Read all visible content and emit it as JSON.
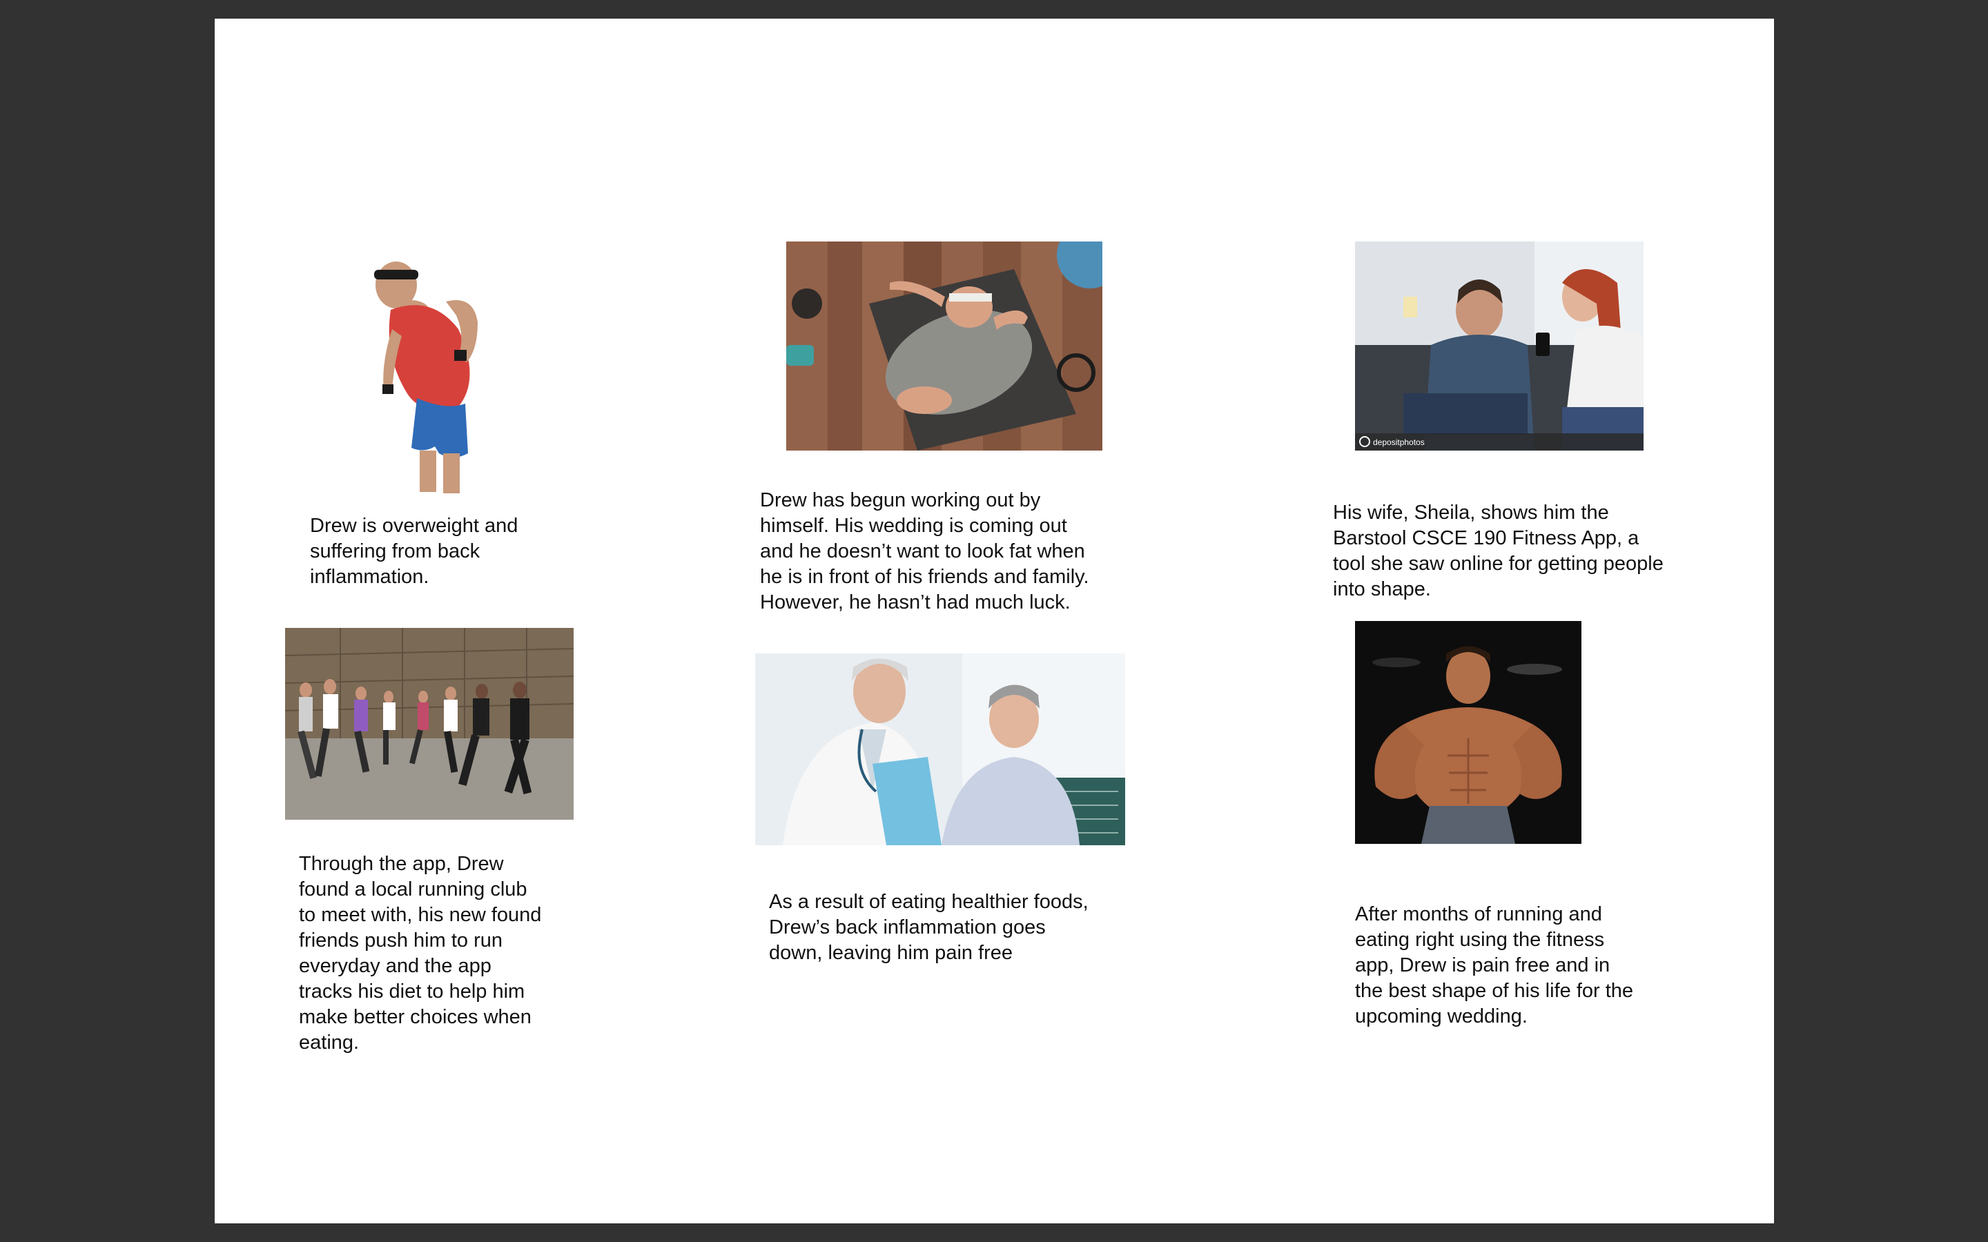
{
  "storyboard": {
    "panels": [
      {
        "image": "overweight-man-back-pain",
        "caption_lines": [
          "Drew is overweight and",
          "suffering from back",
          "inflammation."
        ]
      },
      {
        "image": "man-lying-on-gym-floor",
        "caption_lines": [
          "Drew has begun working out by",
          "himself. His wedding is coming out",
          "and he doesn’t want to look fat when",
          "he is in front of his friends and family.",
          "However, he hasn’t had much luck."
        ]
      },
      {
        "image": "wife-showing-phone-app",
        "caption_lines": [
          "His wife, Sheila, shows him the",
          "Barstool CSCE 190 Fitness App, a",
          "tool she saw online for getting people",
          "into shape."
        ],
        "watermark": "depositphotos"
      },
      {
        "image": "running-club-group",
        "caption_lines": [
          "Through the app, Drew",
          "found a local running club",
          "to meet with, his new found",
          "friends push him to run",
          "everyday and the app",
          "tracks his diet to help him",
          "make better choices when",
          "eating."
        ]
      },
      {
        "image": "doctor-and-patient",
        "caption_lines": [
          "As a result of eating healthier foods,",
          "Drew’s back inflammation goes",
          "down, leaving him pain free"
        ]
      },
      {
        "image": "muscular-man-posing",
        "caption_lines": [
          "After months of running and",
          "eating right using the fitness",
          "app, Drew is pain free and in",
          "the best shape of his life for the",
          "upcoming wedding."
        ]
      }
    ]
  },
  "colors": {
    "viewer_background": "#323232",
    "page_background": "#ffffff",
    "caption_text": "#111111"
  }
}
